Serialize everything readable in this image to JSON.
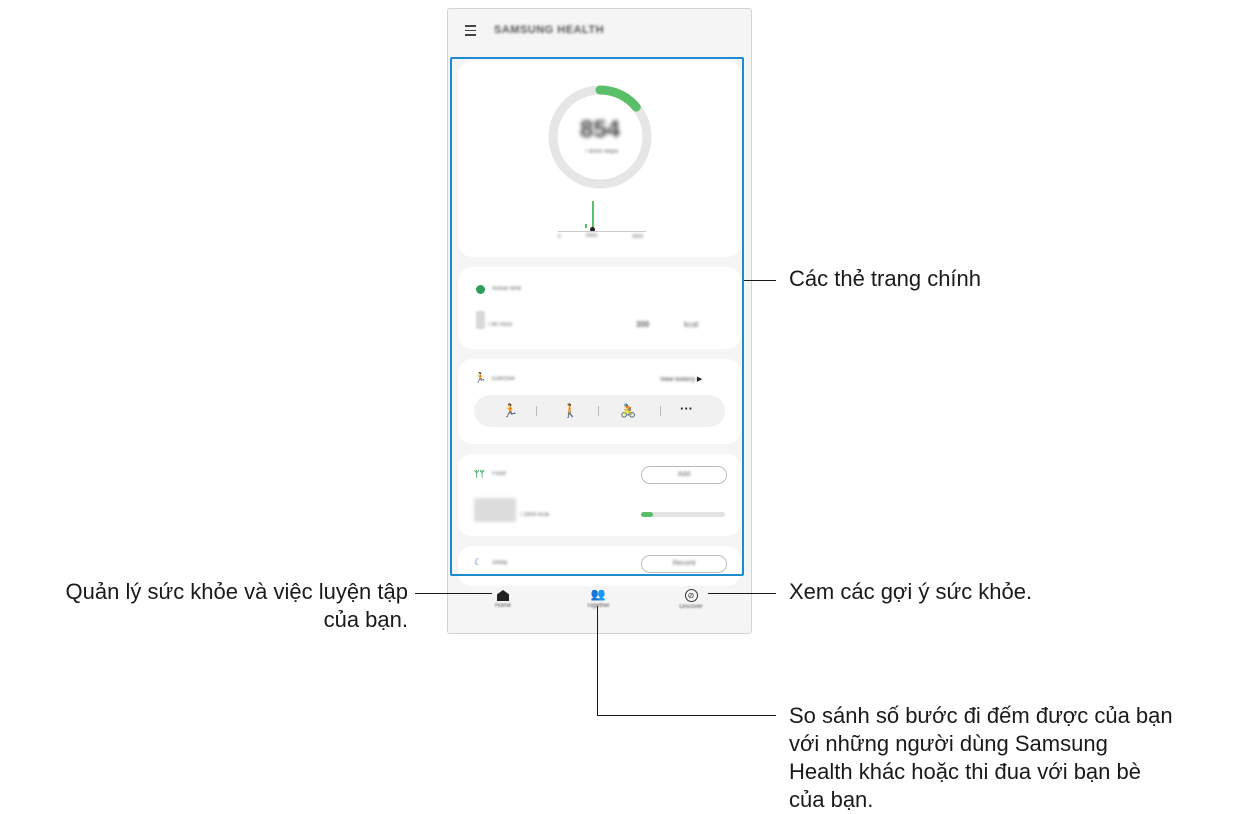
{
  "app": {
    "title": "SAMSUNG HEALTH",
    "menu_icon": "menu-icon"
  },
  "steps_card": {
    "count": "854",
    "goal": "/ 6000 steps",
    "progress": 0.14,
    "accent": "#5bbf6a",
    "axis_left": "0",
    "axis_mid": "6000",
    "axis_right": "3000"
  },
  "active_time_card": {
    "icon": "clock-icon",
    "title": "Active time",
    "value": "1",
    "goal": "/ 90 mins",
    "distance": "300",
    "kcal": "kcal"
  },
  "exercise_card": {
    "icon": "runner-icon",
    "title": "Exercise",
    "link": "View history",
    "modes": [
      "running-icon",
      "walking-icon",
      "cycling-icon",
      "more-icon"
    ],
    "more_label": "···"
  },
  "food_card": {
    "icon": "fork-knife-icon",
    "title": "Food",
    "button": "Add",
    "value": "0",
    "goal": "/ 1600 kcal",
    "progress": 0.14
  },
  "sleep_card": {
    "icon": "moon-icon",
    "title": "Sleep",
    "button": "Record"
  },
  "nav": {
    "home": "Home",
    "together": "Together",
    "discover": "Discover"
  },
  "callouts": {
    "main_cards": "Các thẻ trang chính",
    "home_line1": "Quản lý sức khỏe và việc luyện tập",
    "home_line2": "của bạn.",
    "discover": "Xem các gợi ý sức khỏe.",
    "together_line1": "So sánh số bước đi đếm được của bạn",
    "together_line2": "với những người dùng Samsung",
    "together_line3": "Health khác hoặc thi đua với bạn bè",
    "together_line4": "của bạn."
  },
  "colors": {
    "highlight": "#1f8ad0",
    "green": "#5bbf6a",
    "sleep_icon": "#5a6fd0"
  }
}
